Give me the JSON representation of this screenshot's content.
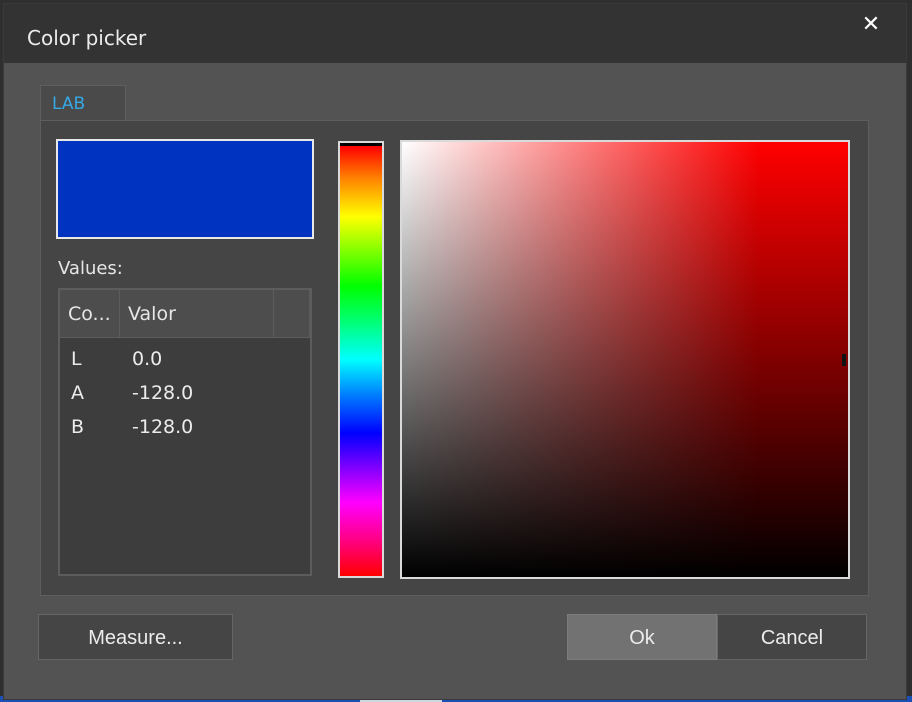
{
  "window": {
    "title": "Color picker",
    "close_glyph": "✕"
  },
  "tabs": [
    {
      "label": "LAB",
      "active": true
    }
  ],
  "preview": {
    "color": "#0033c0"
  },
  "values": {
    "label": "Values:",
    "columns": [
      "Co...",
      "Valor",
      ""
    ],
    "rows": [
      {
        "component": "L",
        "value": "0.0"
      },
      {
        "component": "A",
        "value": "-128.0"
      },
      {
        "component": "B",
        "value": "-128.0"
      }
    ]
  },
  "buttons": {
    "measure": "Measure...",
    "ok": "Ok",
    "cancel": "Cancel"
  },
  "colors": {
    "accent_tab": "#36a8e6",
    "dialog_bg": "#535353",
    "titlebar_bg": "#333333"
  }
}
